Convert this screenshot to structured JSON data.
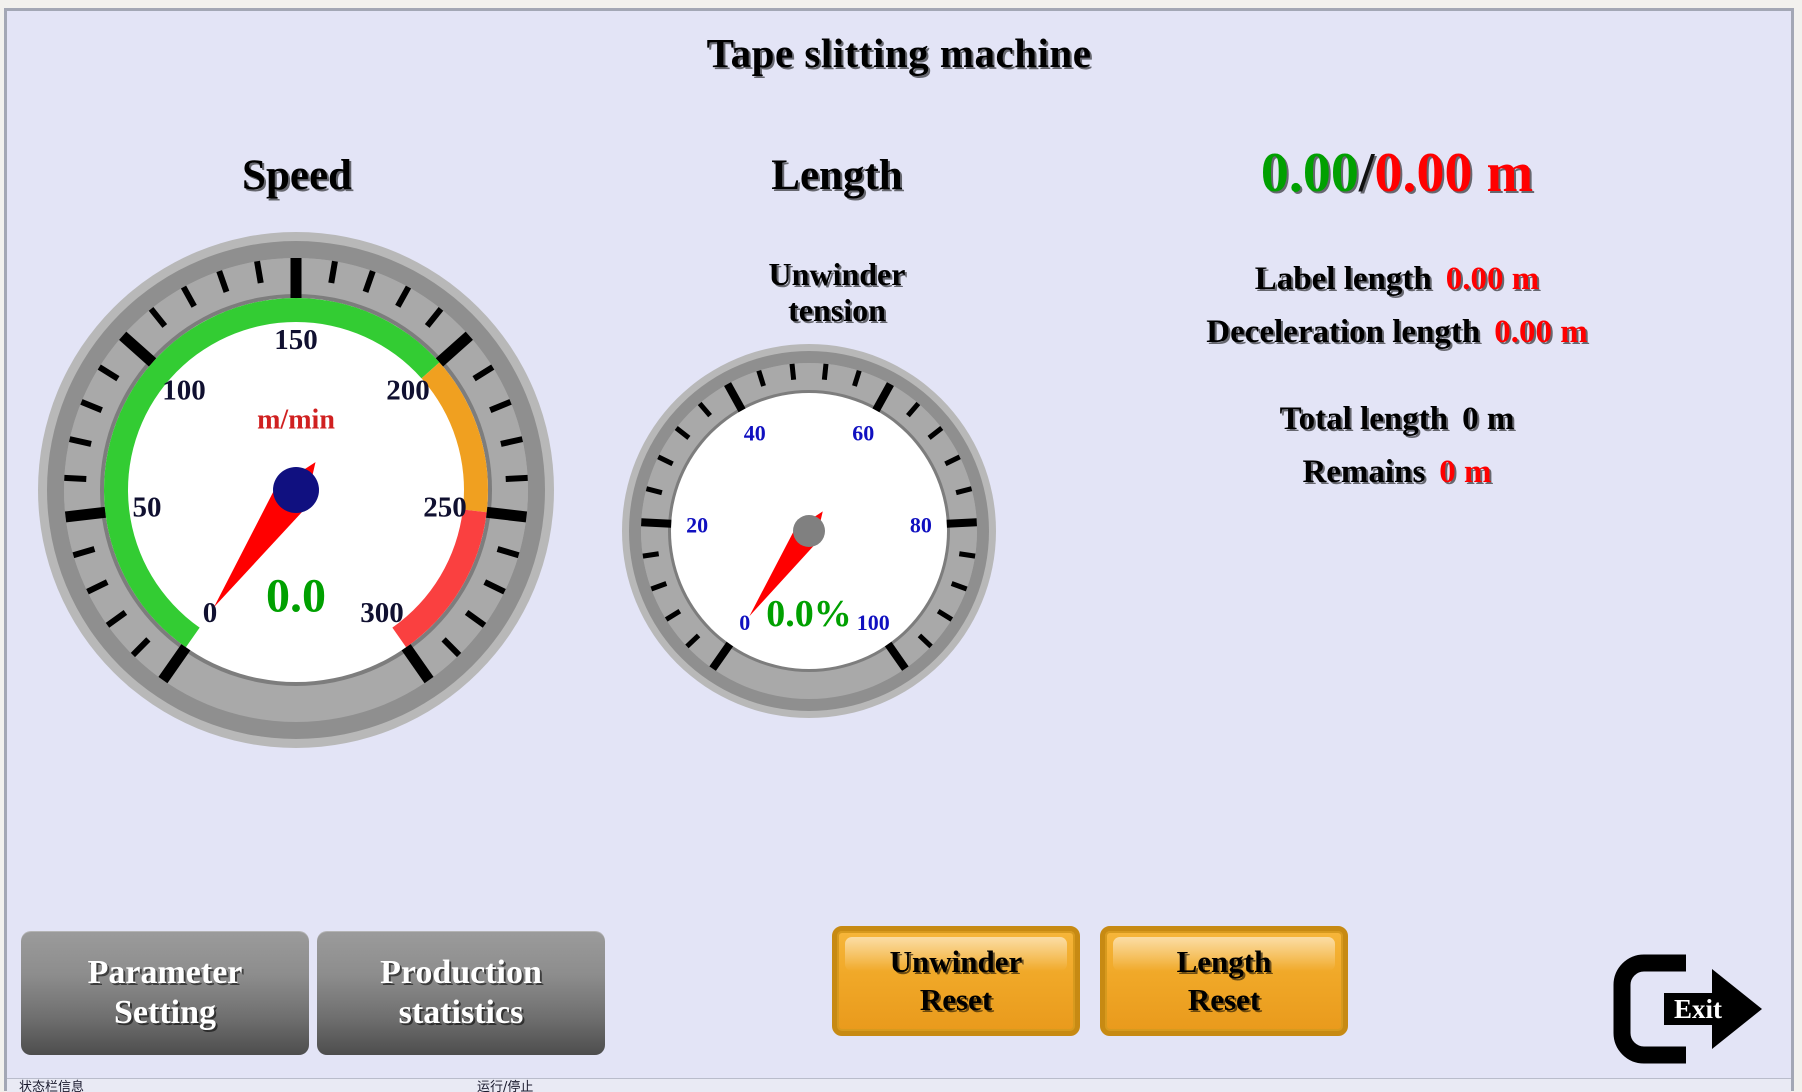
{
  "window": {
    "title": "Tape slitting machine"
  },
  "sections": {
    "speed_heading": "Speed",
    "length_heading": "Length",
    "tension_heading_line1": "Unwinder",
    "tension_heading_line2": "tension"
  },
  "speed_gauge": {
    "name": "speed-gauge",
    "unit_label": "m/min",
    "value_text": "0.0",
    "value": 0.0,
    "min": 0,
    "max": 300,
    "major_step": 50,
    "minor_per_major": 5,
    "tick_labels": [
      "0",
      "50",
      "100",
      "150",
      "200",
      "250",
      "300"
    ],
    "tick_label_color": "#101030",
    "unit_color": "#d02020",
    "value_color": "#00a000",
    "needle_color": "#ff0000",
    "hub_color": "#101080",
    "face_color": "#ffffff",
    "ring_color": "#a9a9a9",
    "bands": [
      {
        "from": 0,
        "to": 200,
        "color": "#33cc33"
      },
      {
        "from": 200,
        "to": 250,
        "color": "#f0a020"
      },
      {
        "from": 250,
        "to": 300,
        "color": "#fa4040"
      }
    ]
  },
  "tension_gauge": {
    "name": "unwinder-tension-gauge",
    "value_text": "0.0%",
    "value": 0.0,
    "min": 0,
    "max": 100,
    "major_step": 20,
    "minor_per_major": 5,
    "tick_labels": [
      "0",
      "20",
      "40",
      "60",
      "80",
      "100"
    ],
    "tick_label_color": "#1010c0",
    "value_color": "#00a000",
    "needle_color": "#ff0000",
    "hub_color": "#808080",
    "face_color": "#ffffff",
    "ring_color": "#a9a9a9",
    "bands": []
  },
  "readout": {
    "length_current": "0.00",
    "length_separator": "/",
    "length_target": "0.00",
    "length_unit": "m",
    "rows": [
      {
        "key": "Label length",
        "value": "0.00 m",
        "value_color": "red"
      },
      {
        "key": "Deceleration length",
        "value": "0.00 m",
        "value_color": "red"
      },
      {
        "key": "Total length",
        "value": "0 m",
        "value_color": "black"
      },
      {
        "key": "Remains",
        "value": "0 m",
        "value_color": "red"
      }
    ]
  },
  "buttons": {
    "parameter_setting_l1": "Parameter",
    "parameter_setting_l2": "Setting",
    "production_statistics_l1": "Production",
    "production_statistics_l2": "statistics",
    "unwinder_reset_l1": "Unwinder",
    "unwinder_reset_l2": "Reset",
    "length_reset_l1": "Length",
    "length_reset_l2": "Reset",
    "exit_label": "Exit"
  },
  "status_bar": {
    "left_text": "状态栏信息",
    "mid_text": "运行/停止"
  },
  "colors": {
    "panel_background": "#e3e4f6",
    "frame_border": "#a3a7b5",
    "accent_green": "#00a000",
    "accent_red": "#ff0000",
    "accent_orange": "#f0a828",
    "button_gray": "#8d8d8d"
  }
}
